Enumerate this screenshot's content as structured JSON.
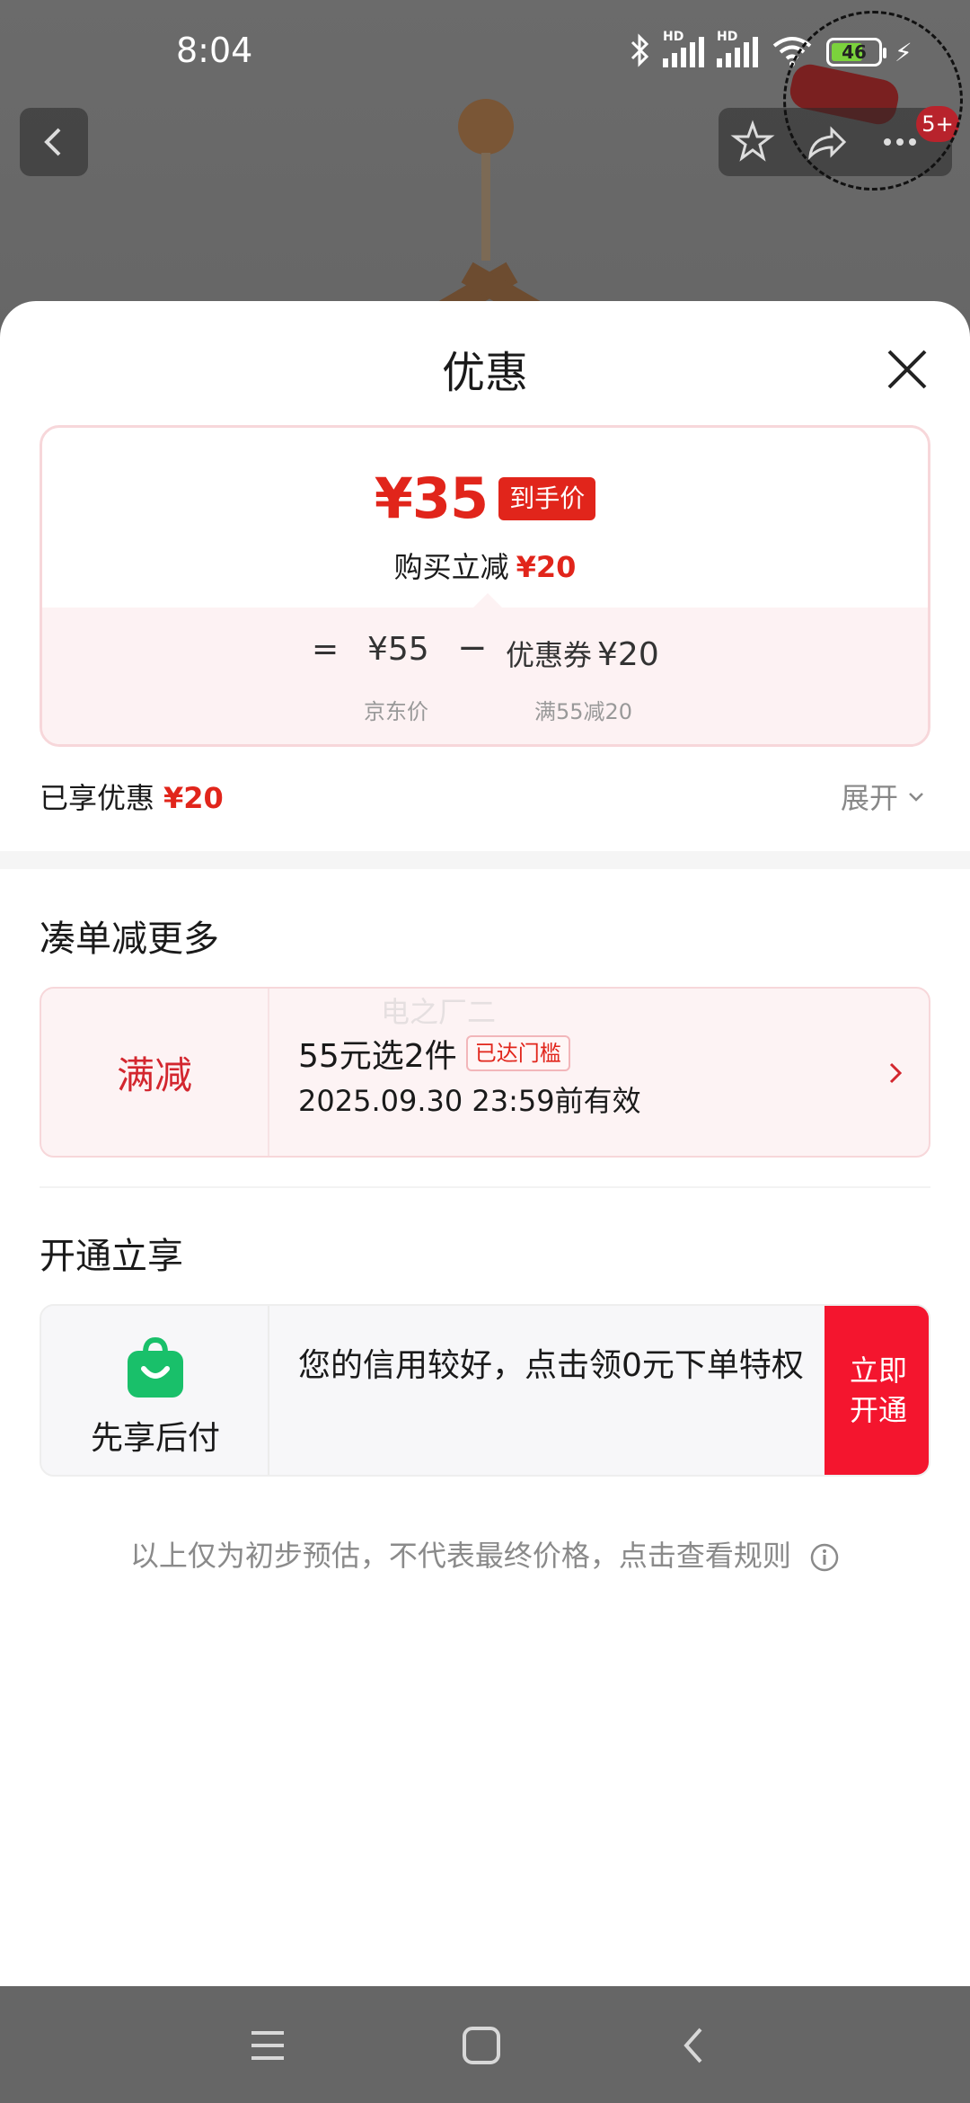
{
  "status_bar": {
    "time": "8:04",
    "network_label": "HD",
    "battery_level": "46"
  },
  "product_header": {
    "cart_badge": "5+"
  },
  "sheet": {
    "title": "优惠",
    "price_card": {
      "final_price": "¥35",
      "final_tag": "到手价",
      "reduce_label": "购买立减",
      "reduce_amount": "¥20",
      "equals": "=",
      "jd_price": "¥55",
      "minus": "−",
      "coupon_label": "优惠券",
      "coupon_amount": "¥20",
      "jd_price_caption": "京东价",
      "coupon_caption": "满55减20"
    },
    "enjoyed": {
      "label": "已享优惠",
      "amount": "¥20",
      "expand_label": "展开"
    },
    "combo_section": {
      "title": "凑单减更多",
      "promo_type": "满减",
      "promo_title": "55元选2件",
      "promo_status": "已达门槛",
      "promo_validity": "2025.09.30 23:59前有效",
      "watermark": "电之厂二"
    },
    "open_section": {
      "title": "开通立享",
      "service_name": "先享后付",
      "service_desc": "您的信用较好，点击领0元下单特权",
      "action_label": "立即开通"
    },
    "footnote": "以上仅为初步预估，不代表最终价格，点击查看规则"
  },
  "colors": {
    "accent_red": "#e1251b",
    "button_red": "#f4152e",
    "pay_green": "#22c55e"
  },
  "icons": [
    "back-icon",
    "star-icon",
    "share-icon",
    "more-icon",
    "close-icon",
    "chevron-down-icon",
    "chevron-right-icon",
    "shopping-bag-icon",
    "info-icon",
    "menu-icon",
    "home-icon",
    "back-nav-icon"
  ]
}
